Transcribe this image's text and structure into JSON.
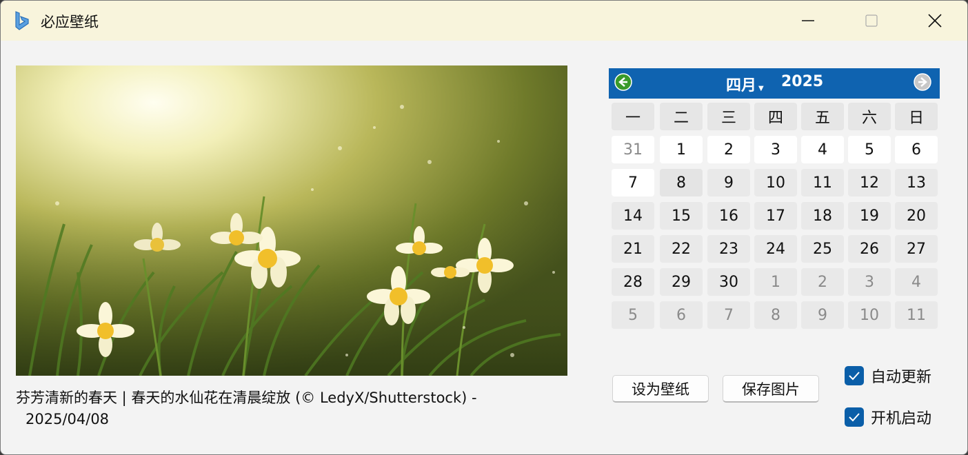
{
  "window": {
    "title": "必应壁纸",
    "icon": "bing-logo-icon"
  },
  "image": {
    "subject": "daffodils",
    "caption_line1": "芬芳清新的春天 | 春天的水仙花在清晨绽放 (© LedyX/Shutterstock) -",
    "caption_line2": "2025/04/08"
  },
  "calendar": {
    "month": "四月",
    "year": "2025",
    "weekdays": [
      "一",
      "二",
      "三",
      "四",
      "五",
      "六",
      "日"
    ],
    "weeks": [
      [
        "31",
        "1",
        "2",
        "3",
        "4",
        "5",
        "6"
      ],
      [
        "7",
        "8",
        "9",
        "10",
        "11",
        "12",
        "13"
      ],
      [
        "14",
        "15",
        "16",
        "17",
        "18",
        "19",
        "20"
      ],
      [
        "21",
        "22",
        "23",
        "24",
        "25",
        "26",
        "27"
      ],
      [
        "28",
        "29",
        "30",
        "1",
        "2",
        "3",
        "4"
      ],
      [
        "5",
        "6",
        "7",
        "8",
        "9",
        "10",
        "11"
      ]
    ],
    "selected_day": "8",
    "colors": {
      "header": "#0f63b0"
    }
  },
  "actions": {
    "set_wallpaper": "设为壁纸",
    "save_image": "保存图片"
  },
  "options": {
    "auto_update": {
      "label": "自动更新",
      "checked": true
    },
    "startup": {
      "label": "开机启动",
      "checked": true
    }
  }
}
